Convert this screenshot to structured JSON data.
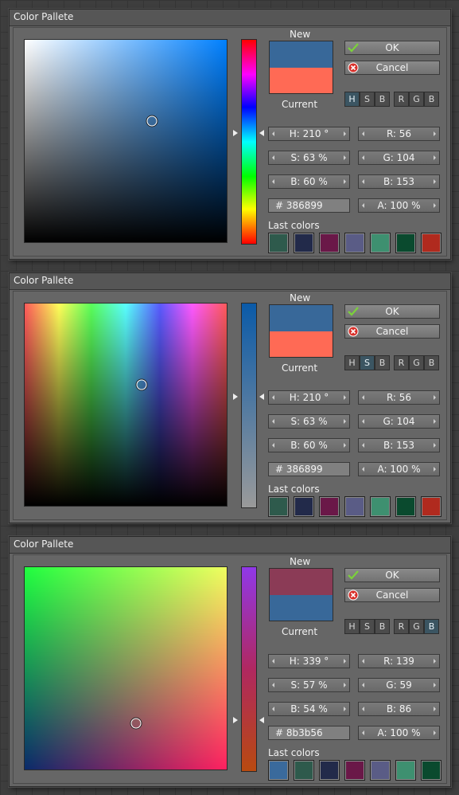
{
  "dialogs": [
    {
      "title": "Color Pallete",
      "mode": "H",
      "new_label": "New",
      "current_label": "Current",
      "new_color": "#386899",
      "current_color": "#ff6a55",
      "ok_label": "OK",
      "cancel_label": "Cancel",
      "modes": [
        "H",
        "S",
        "B",
        "R",
        "G",
        "B"
      ],
      "fields": {
        "h": "H: 210 °",
        "s": "S: 63 %",
        "b": "B: 60 %",
        "r": "R: 56",
        "g": "G: 104",
        "bl": "B: 153",
        "hex": "# 386899",
        "a": "A: 100 %"
      },
      "last_colors_label": "Last colors",
      "last_colors": [
        "#2e5a4c",
        "#222a4a",
        "#6a1848",
        "#5a5c86",
        "#3e9070",
        "#0a4a2e",
        "#b02a1e"
      ]
    },
    {
      "title": "Color Pallete",
      "mode": "S",
      "new_label": "New",
      "current_label": "Current",
      "new_color": "#386899",
      "current_color": "#ff6a55",
      "ok_label": "OK",
      "cancel_label": "Cancel",
      "modes": [
        "H",
        "S",
        "B",
        "R",
        "G",
        "B"
      ],
      "fields": {
        "h": "H: 210 °",
        "s": "S: 63 %",
        "b": "B: 60 %",
        "r": "R: 56",
        "g": "G: 104",
        "bl": "B: 153",
        "hex": "# 386899",
        "a": "A: 100 %"
      },
      "last_colors_label": "Last colors",
      "last_colors": [
        "#2e5a4c",
        "#222a4a",
        "#6a1848",
        "#5a5c86",
        "#3e9070",
        "#0a4a2e",
        "#b02a1e"
      ]
    },
    {
      "title": "Color Pallete",
      "mode": "B",
      "new_label": "New",
      "current_label": "Current",
      "new_color": "#8b3b56",
      "current_color": "#386899",
      "ok_label": "OK",
      "cancel_label": "Cancel",
      "modes": [
        "H",
        "S",
        "B",
        "R",
        "G",
        "B"
      ],
      "fields": {
        "h": "H: 339 °",
        "s": "S: 57 %",
        "b": "B: 54 %",
        "r": "R: 139",
        "g": "G: 59",
        "bl": "B: 86",
        "hex": "# 8b3b56",
        "a": "A: 100 %"
      },
      "last_colors_label": "Last colors",
      "last_colors": [
        "#3a6a9c",
        "#2e5a4c",
        "#222a4a",
        "#6a1848",
        "#5a5c86",
        "#3e9070",
        "#0a4a2e"
      ]
    }
  ]
}
